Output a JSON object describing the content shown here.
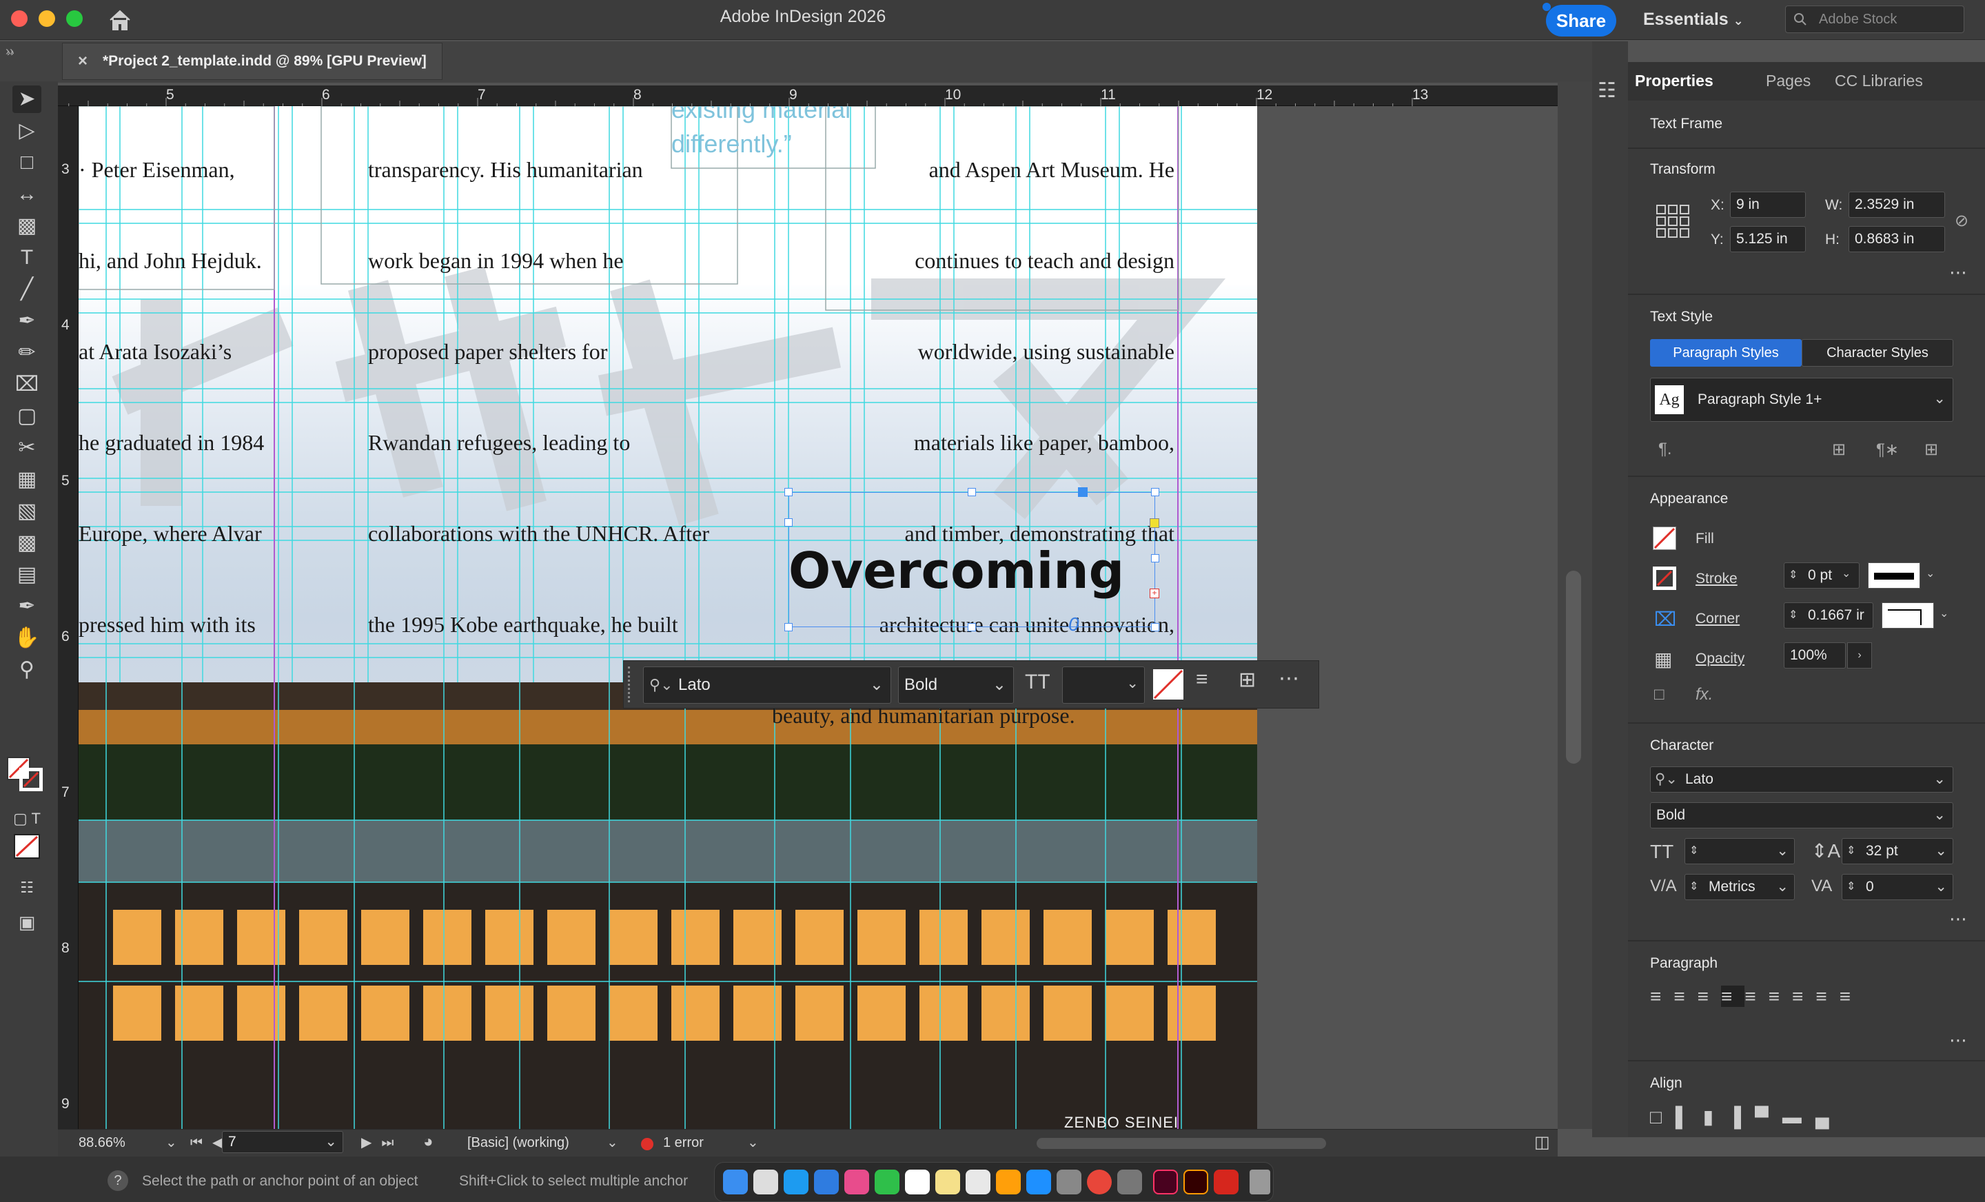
{
  "window": {
    "title": "Adobe InDesign 2026",
    "share_label": "Share",
    "workspace": "Essentials",
    "search_placeholder": "Adobe Stock"
  },
  "document_tab": {
    "label": "*Project 2_template.indd @ 89% [GPU Preview]"
  },
  "ruler": {
    "horizontal": [
      "5",
      "6",
      "7",
      "8",
      "9",
      "10",
      "11",
      "12",
      "13"
    ],
    "vertical": [
      "3",
      "4",
      "5",
      "6",
      "7",
      "8",
      "9"
    ]
  },
  "page": {
    "col1": [
      "· Peter Eisenman,",
      "hi, and John Hejduk.",
      "at Arata Isozaki’s",
      "he graduated in 1984",
      "Europe, where Alvar",
      "pressed him with its"
    ],
    "col2": [
      "transparency. His humanitarian",
      "work began in 1994 when he",
      "proposed paper shelters for",
      "Rwandan refugees, leading to",
      "collaborations with the UNHCR. After",
      "the 1995 Kobe earthquake, he built"
    ],
    "quote": [
      "existing material",
      "differently.”"
    ],
    "col3": [
      "and Aspen Art Museum. He",
      "continues to teach and design",
      "worldwide, using sustainable",
      "materials like paper, bamboo,",
      "and timber, demonstrating that",
      "architecture can unite innovation,",
      "beauty, and humanitarian purpose."
    ],
    "headline": "Overcoming",
    "overflow_mark": "0",
    "photo_credit": "ZENBO SEINEI"
  },
  "control_strip": {
    "font": "Lato",
    "style": "Bold"
  },
  "panel": {
    "tabs": [
      "Properties",
      "Pages",
      "CC Libraries"
    ],
    "object_type": "Text Frame",
    "transform": {
      "title": "Transform",
      "x_label": "X:",
      "x": "9 in",
      "y_label": "Y:",
      "y": "5.125 in",
      "w_label": "W:",
      "w": "2.3529 in",
      "h_label": "H:",
      "h": "0.8683 in"
    },
    "text_style": {
      "title": "Text Style",
      "tab_paragraph": "Paragraph Styles",
      "tab_character": "Character Styles",
      "current": "Paragraph Style 1+",
      "ag": "Ag"
    },
    "appearance": {
      "title": "Appearance",
      "fill": "Fill",
      "stroke": "Stroke",
      "stroke_value": "0 pt",
      "corner": "Corner",
      "corner_value": "0.1667 ir",
      "opacity": "Opacity",
      "opacity_value": "100%"
    },
    "character": {
      "title": "Character",
      "font": "Lato",
      "style": "Bold",
      "leading": "32 pt",
      "kerning": "Metrics",
      "tracking": "0"
    },
    "paragraph": {
      "title": "Paragraph"
    },
    "align": {
      "title": "Align"
    }
  },
  "status": {
    "zoom": "88.66%",
    "page": "7",
    "preflight_profile": "[Basic] (working)",
    "errors": "1 error"
  },
  "hint": {
    "text1": "Select the path or anchor point of an object",
    "text2": "Shift+Click to select multiple anchor"
  },
  "colors": {
    "accent": "#1473e6",
    "guide": "#3fd9e0",
    "margin": "#b05ad0",
    "error": "#e0302a"
  }
}
